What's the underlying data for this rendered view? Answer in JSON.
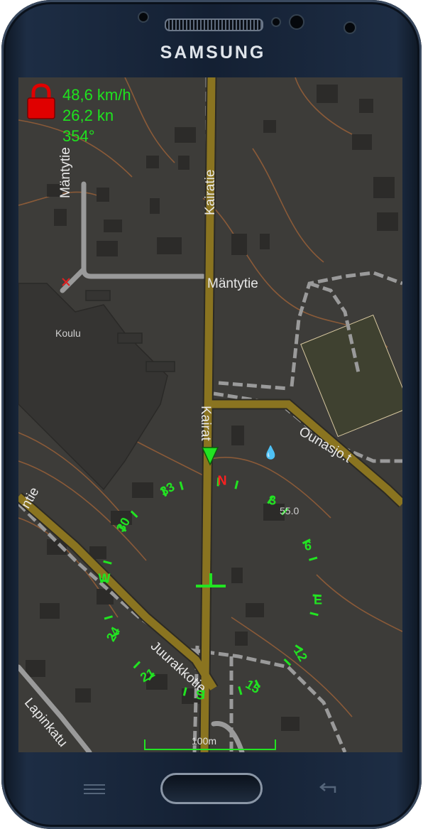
{
  "device": {
    "brand": "SAMSUNG"
  },
  "status": {
    "speed_kmh": "48,6 km/h",
    "speed_kn": "26,2 kn",
    "heading": "354°",
    "lock_icon": "lock-icon",
    "colors": {
      "hud_text": "#1fe31f",
      "lock": "#e00000"
    }
  },
  "map": {
    "labels": {
      "mantytie_vertical": "Mäntytie",
      "kairatie_top": "Kairatie",
      "mantytie_horizontal": "Mäntytie",
      "koulu": "Koulu",
      "kairatie_mid": "Kairat",
      "ounasjo": "Ounasjo.t",
      "juurakkotie": "Juurakkotie",
      "lapinkatu": "Lapinkatu",
      "left_partial": "ntie",
      "elevation": "55.0"
    },
    "colors": {
      "background": "#3d3c39",
      "major_road": "#8a7420",
      "minor_road": "#9a9a9a",
      "contour": "#8a5a38"
    }
  },
  "compass": {
    "labels": {
      "n": "N",
      "n3": "3",
      "n6": "6",
      "e": "E",
      "n12": "12",
      "n15": "15",
      "s": "S",
      "n21": "21",
      "n24": "24",
      "w": "W",
      "n30": "30",
      "n33": "33"
    },
    "colors": {
      "north": "#ff2020",
      "ring": "#22e322"
    }
  },
  "scale": {
    "label": "100m"
  },
  "navbar": {
    "menu_icon": "menu-icon",
    "home_icon": "home-button",
    "back_icon": "back-icon"
  }
}
